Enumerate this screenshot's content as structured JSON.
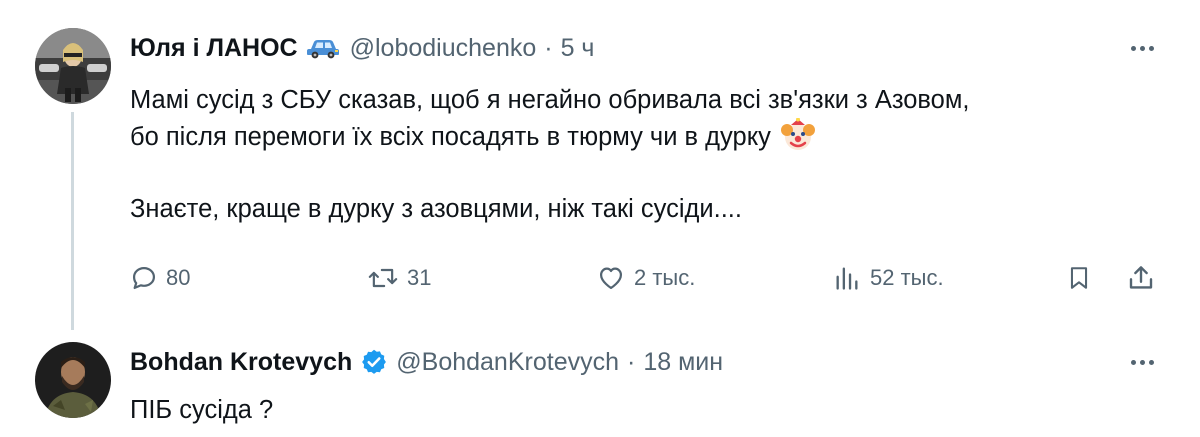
{
  "tweets": [
    {
      "author": {
        "display_name": "Юля і ЛАНОС",
        "handle": "@lobodiuchenko",
        "badge_icon": "car-emoji-icon"
      },
      "time": "5 ч",
      "text": {
        "line1": "Мамі сусід з СБУ сказав, щоб я негайно обривала всі зв'язки з Азовом,",
        "line2": "бо після перемоги їх всіх посадять в тюрму чи в дурку",
        "line3": "Знаєте, краще в дурку з азовцями, ніж такі сусіди...."
      },
      "emoji": "clown-face-icon",
      "actions": {
        "reply_count": "80",
        "retweet_count": "31",
        "like_count": "2 тыс.",
        "views_count": "52 тыс."
      }
    },
    {
      "author": {
        "display_name": "Bohdan Krotevych",
        "handle": "@BohdanKrotevych",
        "badge_icon": "verified-badge-icon"
      },
      "time": "18 мин",
      "text": {
        "line1": "ПІБ сусіда ?"
      }
    }
  ],
  "colors": {
    "text_primary": "#0f1419",
    "text_secondary": "#536471",
    "verified_blue": "#1d9bf0",
    "thread_line": "#cfd9de"
  }
}
